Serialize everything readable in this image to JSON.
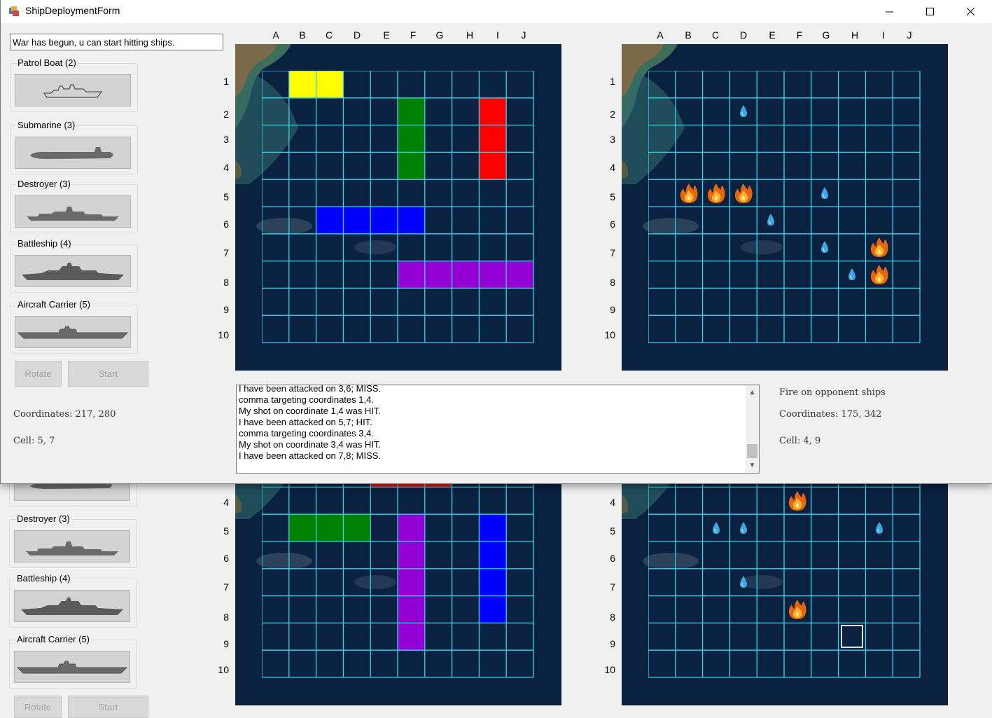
{
  "window": {
    "title": "ShipDeploymentForm",
    "minimize_icon": "minimize-icon",
    "maximize_icon": "maximize-icon",
    "close_icon": "close-icon"
  },
  "status_message": "War has begun,  u can start hitting ships.",
  "ships": [
    {
      "label": "Patrol Boat (2)",
      "icon": "patrol-boat-icon"
    },
    {
      "label": "Submarine (3)",
      "icon": "submarine-icon"
    },
    {
      "label": "Destroyer (3)",
      "icon": "destroyer-icon"
    },
    {
      "label": "Battleship (4)",
      "icon": "battleship-icon"
    },
    {
      "label": "Aircraft Carrier (5)",
      "icon": "aircraft-carrier-icon"
    }
  ],
  "buttons": {
    "rotate": "Rotate",
    "start": "Start"
  },
  "left_info": {
    "coordinates": "Coordinates: 217, 280",
    "cell": "Cell: 5, 7"
  },
  "right_info": {
    "title": "Fire on opponent ships",
    "coordinates": "Coordinates: 175, 342",
    "cell": "Cell: 4, 9"
  },
  "columns": [
    "A",
    "B",
    "C",
    "D",
    "E",
    "F",
    "G",
    "H",
    "I",
    "J"
  ],
  "rows": [
    "1",
    "2",
    "3",
    "4",
    "5",
    "6",
    "7",
    "8",
    "9",
    "10"
  ],
  "log": [
    "I have been attacked on 3,6; MISS.",
    "comma targeting coordinates 1,4.",
    "My shot on coordinate 1,4 was HIT.",
    "I have been attacked on 5,7; HIT.",
    "comma targeting coordinates 3,4.",
    "My shot on coordinate 3,4 was HIT.",
    "I have been attacked on 7,8; MISS."
  ],
  "colors": {
    "grid_line": "#2fd6f0",
    "yellow": "#ffff00",
    "green": "#008000",
    "red": "#ff0000",
    "blue": "#0000ff",
    "purple": "#9400d3"
  },
  "front_player_ships": [
    {
      "color": "yellow",
      "cells": [
        [
          1,
          0
        ],
        [
          2,
          0
        ]
      ]
    },
    {
      "color": "green",
      "cells": [
        [
          5,
          1
        ],
        [
          5,
          2
        ],
        [
          5,
          3
        ]
      ]
    },
    {
      "color": "red",
      "cells": [
        [
          8,
          1
        ],
        [
          8,
          2
        ],
        [
          8,
          3
        ]
      ]
    },
    {
      "color": "blue",
      "cells": [
        [
          2,
          5
        ],
        [
          3,
          5
        ],
        [
          4,
          5
        ],
        [
          5,
          5
        ]
      ]
    },
    {
      "color": "purple",
      "cells": [
        [
          5,
          7
        ],
        [
          6,
          7
        ],
        [
          7,
          7
        ],
        [
          8,
          7
        ],
        [
          9,
          7
        ]
      ]
    }
  ],
  "front_opponent_markers": [
    {
      "type": "miss",
      "cell": [
        3,
        1
      ]
    },
    {
      "type": "hit",
      "cell": [
        1,
        4
      ]
    },
    {
      "type": "hit",
      "cell": [
        2,
        4
      ]
    },
    {
      "type": "hit",
      "cell": [
        3,
        4
      ]
    },
    {
      "type": "miss",
      "cell": [
        6,
        4
      ]
    },
    {
      "type": "miss",
      "cell": [
        4,
        5
      ]
    },
    {
      "type": "miss",
      "cell": [
        6,
        6
      ]
    },
    {
      "type": "hit",
      "cell": [
        8,
        6
      ]
    },
    {
      "type": "miss",
      "cell": [
        7,
        7
      ]
    },
    {
      "type": "hit",
      "cell": [
        8,
        7
      ]
    }
  ],
  "back_player_ships": [
    {
      "color": "red",
      "cells": [
        [
          4,
          2
        ],
        [
          5,
          2
        ],
        [
          6,
          2
        ]
      ]
    },
    {
      "color": "green",
      "cells": [
        [
          1,
          4
        ],
        [
          2,
          4
        ],
        [
          3,
          4
        ]
      ]
    },
    {
      "color": "purple",
      "cells": [
        [
          5,
          4
        ],
        [
          5,
          5
        ],
        [
          5,
          6
        ],
        [
          5,
          7
        ],
        [
          5,
          8
        ]
      ]
    },
    {
      "color": "blue",
      "cells": [
        [
          8,
          4
        ],
        [
          8,
          5
        ],
        [
          8,
          6
        ],
        [
          8,
          7
        ]
      ]
    }
  ],
  "back_opponent_markers": [
    {
      "type": "hit",
      "cell": [
        5,
        3
      ]
    },
    {
      "type": "miss",
      "cell": [
        2,
        4
      ]
    },
    {
      "type": "miss",
      "cell": [
        3,
        4
      ]
    },
    {
      "type": "miss",
      "cell": [
        8,
        4
      ]
    },
    {
      "type": "miss",
      "cell": [
        3,
        6
      ]
    },
    {
      "type": "hit",
      "cell": [
        5,
        7
      ]
    },
    {
      "type": "target",
      "cell": [
        7,
        8
      ]
    }
  ],
  "back_row_labels": [
    "4",
    "5",
    "6",
    "7",
    "8",
    "9",
    "10"
  ]
}
